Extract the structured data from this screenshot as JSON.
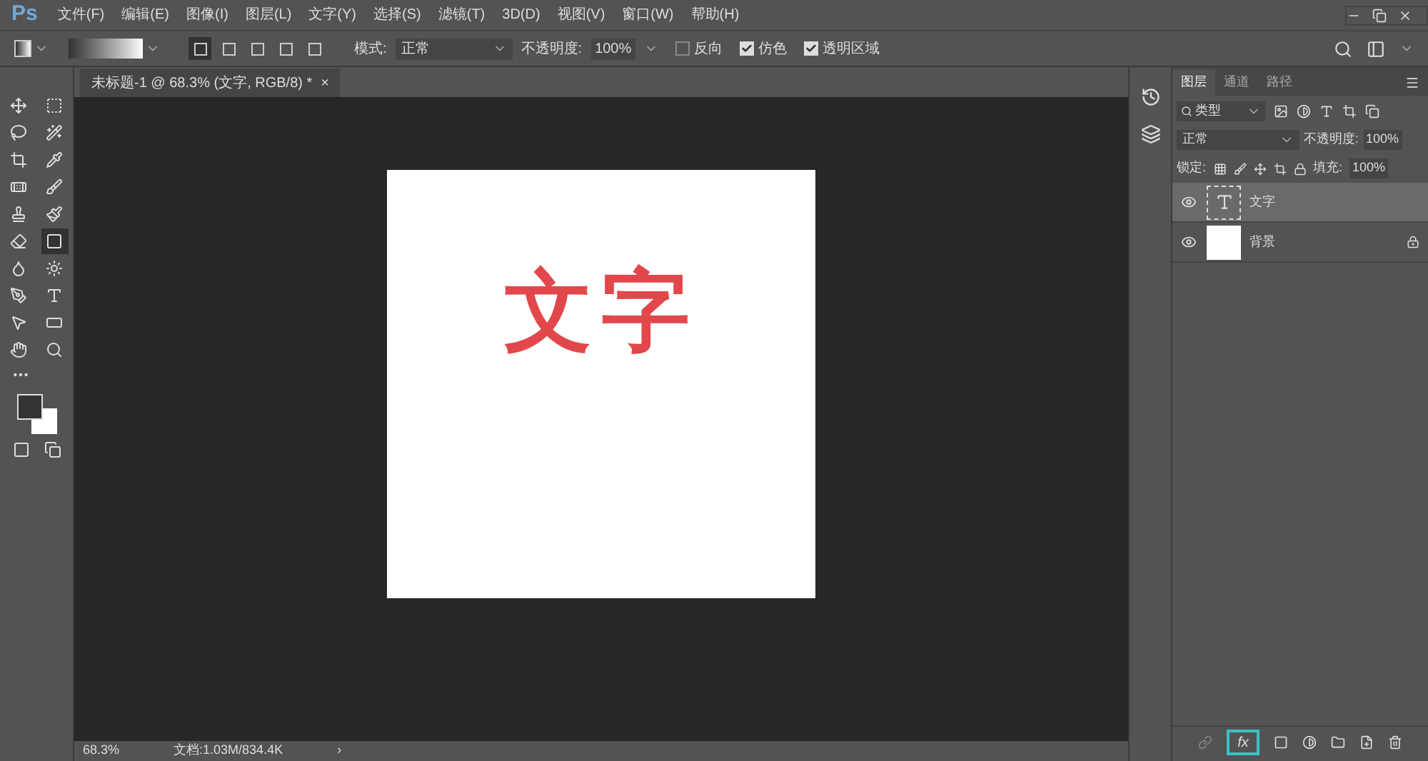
{
  "app": {
    "logo": "Ps"
  },
  "menu": [
    "文件(F)",
    "编辑(E)",
    "图像(I)",
    "图层(L)",
    "文字(Y)",
    "选择(S)",
    "滤镜(T)",
    "3D(D)",
    "视图(V)",
    "窗口(W)",
    "帮助(H)"
  ],
  "options": {
    "gradient_types": [
      {
        "selected": true
      },
      {
        "selected": false
      },
      {
        "selected": false
      },
      {
        "selected": false
      },
      {
        "selected": false
      }
    ],
    "mode_label": "模式:",
    "mode_value": "正常",
    "opacity_label": "不透明度:",
    "opacity_value": "100%",
    "checkboxes": [
      {
        "label": "反向",
        "checked": false
      },
      {
        "label": "仿色",
        "checked": true
      },
      {
        "label": "透明区域",
        "checked": true
      }
    ]
  },
  "tools": [
    {
      "selected": false
    },
    {
      "selected": false
    },
    {
      "selected": false
    },
    {
      "selected": false
    },
    {
      "selected": false
    },
    {
      "selected": false
    },
    {
      "selected": false
    },
    {
      "selected": false
    },
    {
      "selected": false
    },
    {
      "selected": false
    },
    {
      "selected": false
    },
    {
      "selected": true
    },
    {
      "selected": false
    },
    {
      "selected": false
    },
    {
      "selected": false
    },
    {
      "selected": false
    },
    {
      "selected": false
    },
    {
      "selected": false
    },
    {
      "selected": false
    },
    {
      "selected": false
    }
  ],
  "document": {
    "tab_title": "未标题-1 @ 68.3% (文字, RGB/8) *",
    "close": "×",
    "canvas_text": "文字"
  },
  "status_bar": {
    "zoom": "68.3%",
    "doc_size": "文档:1.03M/834.4K",
    "arrow": "›"
  },
  "layers_panel": {
    "tabs": [
      {
        "label": "图层",
        "selected": true
      },
      {
        "label": "通道",
        "selected": false
      },
      {
        "label": "路径",
        "selected": false
      }
    ],
    "filter": "类型",
    "blend_mode": "正常",
    "opacity_label": "不透明度:",
    "opacity_value": "100%",
    "lock_label": "锁定:",
    "fill_label": "填充:",
    "fill_value": "100%",
    "layers": [
      {
        "name": "文字",
        "kind": "text",
        "selected": true,
        "visible": true,
        "locked": false
      },
      {
        "name": "背景",
        "kind": "fill",
        "selected": false,
        "visible": true,
        "locked": true
      }
    ],
    "footer": {
      "fx_label": "fx",
      "fx_highlighted": true
    }
  }
}
